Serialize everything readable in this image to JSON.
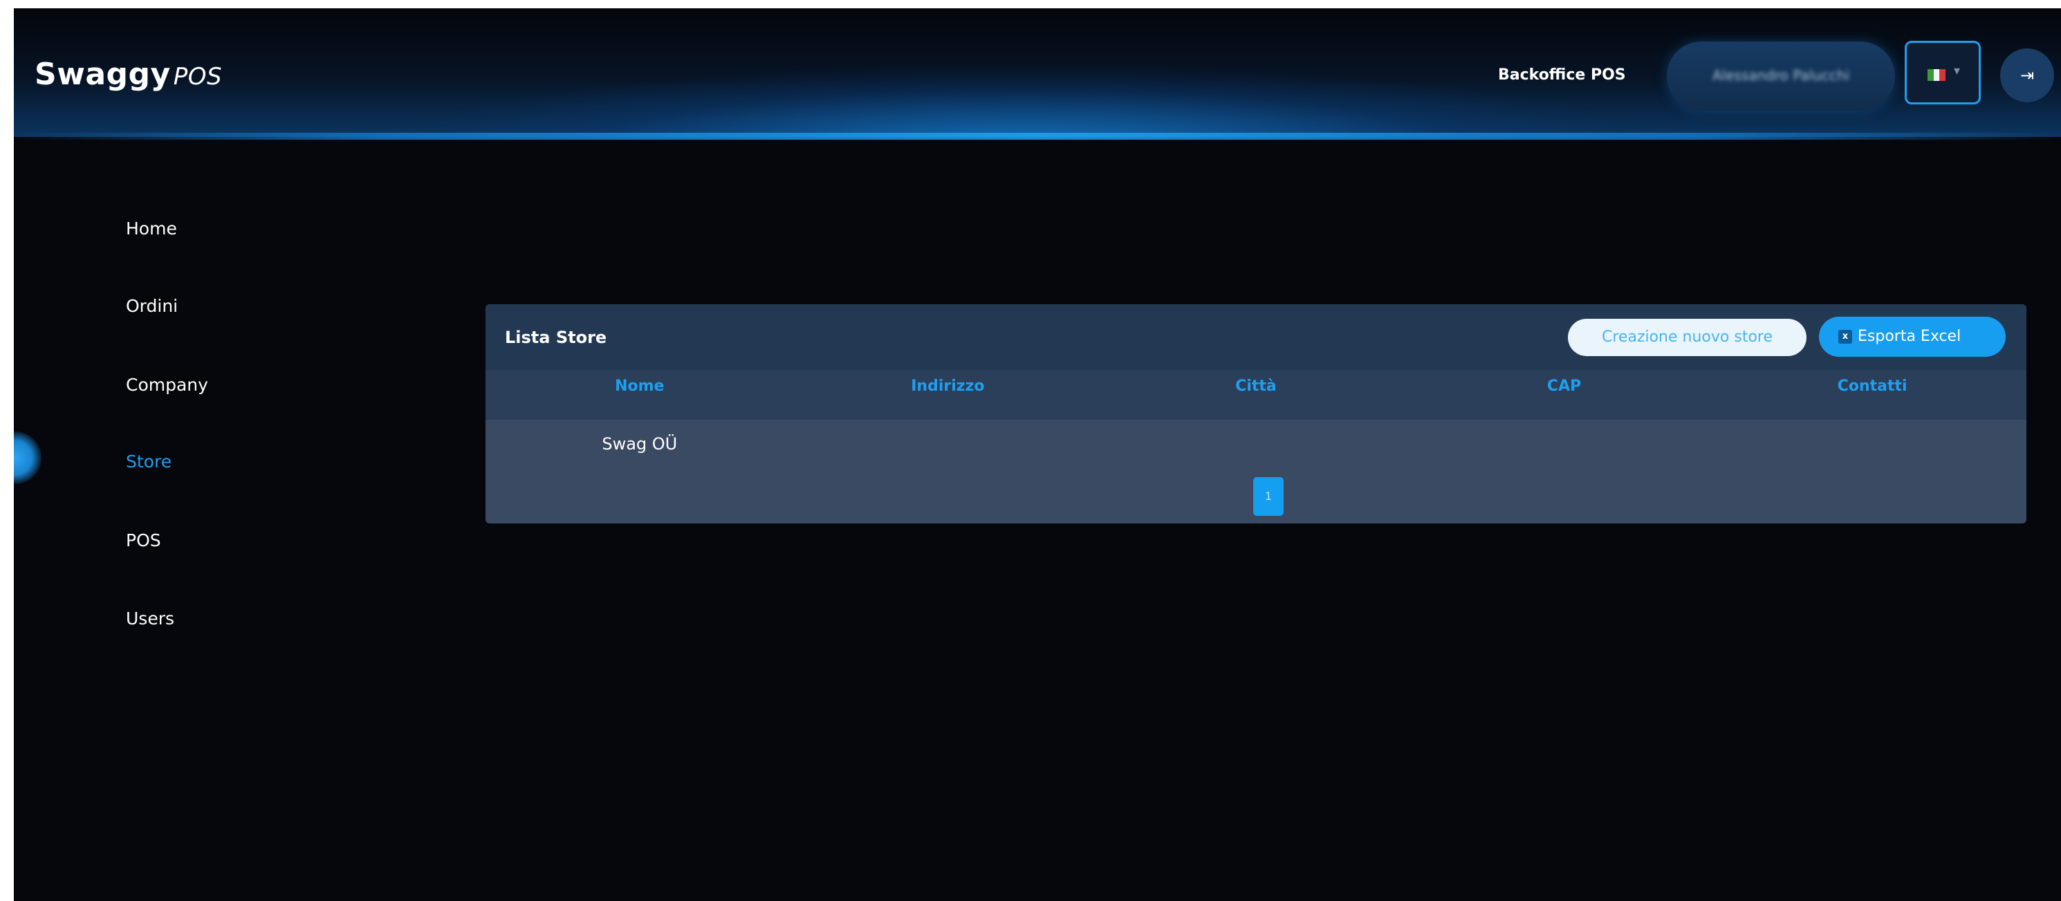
{
  "colors": {
    "accent": "#1e9ff0",
    "background": "#05070c",
    "panel": "#3a4a62",
    "panel_header": "#233853",
    "create_button_bg": "#e9f4fb",
    "export_button_bg": "#179ef0"
  },
  "header": {
    "logo_main": "Swaggy",
    "logo_suffix": "POS",
    "app_title": "Backoffice POS",
    "user_name": "Alessandro Palucchi",
    "language_flag": "italy-flag",
    "language_chevron": "▾",
    "logout_icon": "logout-icon",
    "logout_glyph": "⇥"
  },
  "sidebar": {
    "active": "Store",
    "items": [
      {
        "label": "Home"
      },
      {
        "label": "Ordini"
      },
      {
        "label": "Company"
      },
      {
        "label": "Store"
      },
      {
        "label": "POS"
      },
      {
        "label": "Users"
      }
    ]
  },
  "store_panel": {
    "title": "Lista Store",
    "create_label": "Creazione nuovo store",
    "export_label": "Esporta Excel",
    "export_icon": "excel-icon",
    "export_icon_glyph": "x",
    "columns": [
      "Nome",
      "Indirizzo",
      "Città",
      "CAP",
      "Contatti"
    ],
    "rows": [
      [
        "Swag OÜ",
        "",
        "",
        "",
        ""
      ]
    ],
    "pagination": {
      "current_page": "1"
    }
  }
}
